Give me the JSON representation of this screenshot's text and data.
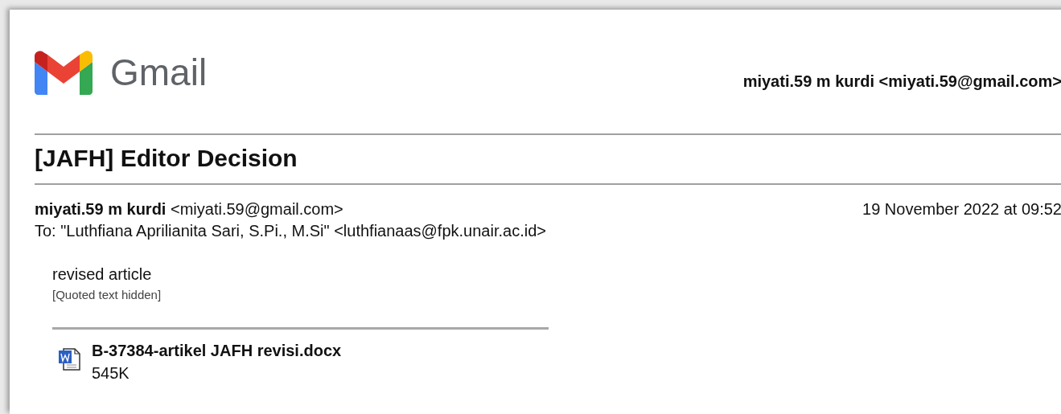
{
  "header": {
    "brand": "Gmail",
    "account": "miyati.59 m kurdi <miyati.59@gmail.com>"
  },
  "subject": "[JAFH] Editor Decision",
  "message": {
    "sender_name": "miyati.59 m kurdi",
    "sender_email": "<miyati.59@gmail.com>",
    "date": "19 November 2022 at 09:52",
    "to": "To: \"Luthfiana Aprilianita Sari, S.Pi., M.Si\" <luthfianaas@fpk.unair.ac.id>",
    "body": "revised article",
    "quoted": "[Quoted text hidden]"
  },
  "attachments": [
    {
      "name": "B-37384-artikel JAFH revisi.docx",
      "size": "545K"
    }
  ]
}
